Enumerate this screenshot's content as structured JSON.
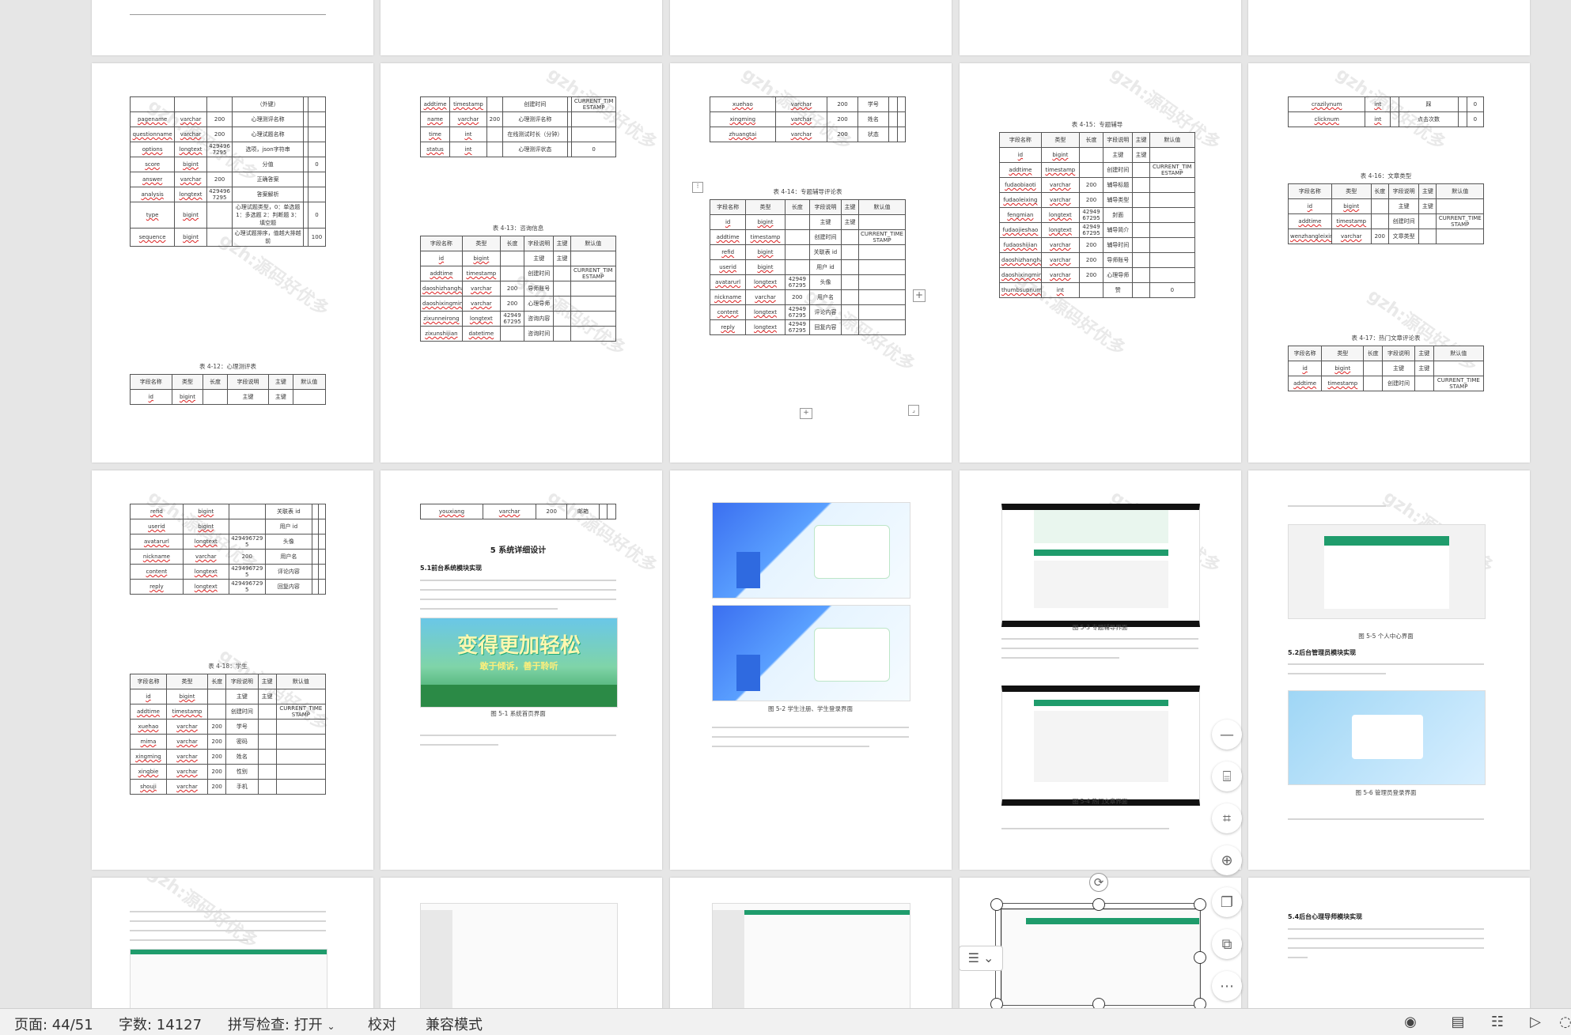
{
  "watermark": "gzh:源码好优多",
  "pages": {
    "p1": {
      "rows": [
        [
          "",
          "",
          "",
          "（外键）",
          "",
          ""
        ],
        [
          "pagename",
          "varchar",
          "200",
          "心理测评名称",
          "",
          ""
        ],
        [
          "questionname",
          "varchar",
          "200",
          "心理试题名称",
          "",
          ""
        ],
        [
          "options",
          "longtext",
          "4294967295",
          "选项，json字符串",
          "",
          ""
        ],
        [
          "score",
          "bigint",
          "",
          "分值",
          "",
          "0"
        ],
        [
          "answer",
          "varchar",
          "200",
          "正确答案",
          "",
          ""
        ],
        [
          "analysis",
          "longtext",
          "4294967295",
          "答案解析",
          "",
          ""
        ],
        [
          "type",
          "bigint",
          "",
          "心理试题类型，0：单选题 1：多选题 2：判断题 3：填空题",
          "",
          "0"
        ],
        [
          "sequence",
          "bigint",
          "",
          "心理试题排序，值越大排越前",
          "",
          "100"
        ]
      ],
      "caption": "表 4-12：心理测评表",
      "header": [
        "字段名称",
        "类型",
        "长度",
        "字段说明",
        "主键",
        "默认值"
      ],
      "rows2": [
        [
          "id",
          "bigint",
          "",
          "主键",
          "主键",
          ""
        ]
      ]
    },
    "p2": {
      "rows": [
        [
          "addtime",
          "timestamp",
          "",
          "创建时间",
          "",
          "CURRENT_TIMESTAMP"
        ],
        [
          "name",
          "varchar",
          "200",
          "心理测评名称",
          "",
          ""
        ],
        [
          "time",
          "int",
          "",
          "在线测试时长（分钟）",
          "",
          ""
        ],
        [
          "status",
          "int",
          "",
          "心理测评状态",
          "",
          "0"
        ]
      ],
      "caption": "表 4-13：咨询信息",
      "header": [
        "字段名称",
        "类型",
        "长度",
        "字段说明",
        "主键",
        "默认值"
      ],
      "rows2": [
        [
          "id",
          "bigint",
          "",
          "主键",
          "主键",
          ""
        ],
        [
          "addtime",
          "timestamp",
          "",
          "创建时间",
          "",
          "CURRENT_TIMESTAMP"
        ],
        [
          "daoshizhanghao",
          "varchar",
          "200",
          "导师账号",
          "",
          ""
        ],
        [
          "daoshixingming",
          "varchar",
          "200",
          "心理导师",
          "",
          ""
        ],
        [
          "zixunneirong",
          "longtext",
          "4294967295",
          "咨询内容",
          "",
          ""
        ],
        [
          "zixunshijian",
          "datetime",
          "",
          "咨询时间",
          "",
          ""
        ]
      ]
    },
    "p3": {
      "rows": [
        [
          "xuehao",
          "varchar",
          "200",
          "学号",
          "",
          ""
        ],
        [
          "xingming",
          "varchar",
          "200",
          "姓名",
          "",
          ""
        ],
        [
          "zhuangtai",
          "varchar",
          "200",
          "状态",
          "",
          ""
        ]
      ],
      "caption": "表 4-14：专题辅导评论表",
      "header": [
        "字段名称",
        "类型",
        "长度",
        "字段说明",
        "主键",
        "默认值"
      ],
      "rows2": [
        [
          "id",
          "bigint",
          "",
          "主键",
          "主键",
          ""
        ],
        [
          "addtime",
          "timestamp",
          "",
          "创建时间",
          "",
          "CURRENT_TIMESTAMP"
        ],
        [
          "refid",
          "bigint",
          "",
          "关联表 id",
          "",
          ""
        ],
        [
          "userid",
          "bigint",
          "",
          "用户 id",
          "",
          ""
        ],
        [
          "avatarurl",
          "longtext",
          "4294967295",
          "头像",
          "",
          ""
        ],
        [
          "nickname",
          "varchar",
          "200",
          "用户名",
          "",
          ""
        ],
        [
          "content",
          "longtext",
          "4294967295",
          "评论内容",
          "",
          ""
        ],
        [
          "reply",
          "longtext",
          "4294967295",
          "回复内容",
          "",
          ""
        ]
      ]
    },
    "p4": {
      "caption": "表 4-15：专题辅导",
      "header": [
        "字段名称",
        "类型",
        "长度",
        "字段说明",
        "主键",
        "默认值"
      ],
      "rows": [
        [
          "id",
          "bigint",
          "",
          "主键",
          "主键",
          ""
        ],
        [
          "addtime",
          "timestamp",
          "",
          "创建时间",
          "",
          "CURRENT_TIMESTAMP"
        ],
        [
          "fudaobiaoti",
          "varchar",
          "200",
          "辅导标题",
          "",
          ""
        ],
        [
          "fudaoleixing",
          "varchar",
          "200",
          "辅导类型",
          "",
          ""
        ],
        [
          "fengmian",
          "longtext",
          "4294967295",
          "封面",
          "",
          ""
        ],
        [
          "fudaojieshao",
          "longtext",
          "4294967295",
          "辅导简介",
          "",
          ""
        ],
        [
          "fudaoshijian",
          "varchar",
          "200",
          "辅导时间",
          "",
          ""
        ],
        [
          "daoshizhanghao",
          "varchar",
          "200",
          "导师账号",
          "",
          ""
        ],
        [
          "daoshixingming",
          "varchar",
          "200",
          "心理导师",
          "",
          ""
        ],
        [
          "thumbsupnum",
          "int",
          "",
          "赞",
          "",
          "0"
        ]
      ]
    },
    "p5": {
      "rows": [
        [
          "crazilynum",
          "int",
          "",
          "踩",
          "",
          "0"
        ],
        [
          "clicknum",
          "int",
          "",
          "点击次数",
          "",
          "0"
        ]
      ],
      "caption": "表 4-16：文章类型",
      "header": [
        "字段名称",
        "类型",
        "长度",
        "字段说明",
        "主键",
        "默认值"
      ],
      "rows2": [
        [
          "id",
          "bigint",
          "",
          "主键",
          "主键",
          ""
        ],
        [
          "addtime",
          "timestamp",
          "",
          "创建时间",
          "",
          "CURRENT_TIMESTAMP"
        ],
        [
          "wenzhangleixing",
          "varchar",
          "200",
          "文章类型",
          "",
          ""
        ]
      ],
      "caption2": "表 4-17：热门文章评论表",
      "rows3": [
        [
          "id",
          "bigint",
          "",
          "主键",
          "主键",
          ""
        ],
        [
          "addtime",
          "timestamp",
          "",
          "创建时间",
          "",
          "CURRENT_TIMESTAMP"
        ]
      ]
    },
    "p6": {
      "rows": [
        [
          "refid",
          "bigint",
          "",
          "关联表 id",
          "",
          ""
        ],
        [
          "userid",
          "bigint",
          "",
          "用户 id",
          "",
          ""
        ],
        [
          "avatarurl",
          "longtext",
          "4294967295",
          "头像",
          "",
          ""
        ],
        [
          "nickname",
          "varchar",
          "200",
          "用户名",
          "",
          ""
        ],
        [
          "content",
          "longtext",
          "4294967295",
          "评论内容",
          "",
          ""
        ],
        [
          "reply",
          "longtext",
          "4294967295",
          "回复内容",
          "",
          ""
        ]
      ],
      "caption": "表 4-18：学生",
      "header": [
        "字段名称",
        "类型",
        "长度",
        "字段说明",
        "主键",
        "默认值"
      ],
      "rows2": [
        [
          "id",
          "bigint",
          "",
          "主键",
          "主键",
          ""
        ],
        [
          "addtime",
          "timestamp",
          "",
          "创建时间",
          "",
          "CURRENT_TIMESTAMP"
        ],
        [
          "xuehao",
          "varchar",
          "200",
          "学号",
          "",
          ""
        ],
        [
          "mima",
          "varchar",
          "200",
          "密码",
          "",
          ""
        ],
        [
          "xingming",
          "varchar",
          "200",
          "姓名",
          "",
          ""
        ],
        [
          "xingbie",
          "varchar",
          "200",
          "性别",
          "",
          ""
        ],
        [
          "shouji",
          "varchar",
          "200",
          "手机",
          "",
          ""
        ]
      ]
    },
    "p7": {
      "toprow": [
        "youxiang",
        "varchar",
        "200",
        "邮箱",
        "",
        ""
      ],
      "heading": "5 系统详细设计",
      "sub": "5.1前台系统模块实现",
      "banner_line1": "变得更加轻松",
      "banner_line2": "敢于倾诉，善于聆听",
      "fig": "图 5-1 系统首页界面"
    },
    "p8": {
      "fig": "图 5-2 学生注册、学生登录界面"
    },
    "p9": {
      "fig1": "图 5-3 专题辅导界面",
      "fig2": "图 5-4 热门文章界面"
    },
    "p10": {
      "fig1": "图 5-5 个人中心界面",
      "sub": "5.2后台管理员模块实现",
      "fig2": "图 5-6 管理员登录界面"
    },
    "p15": {
      "sub": "5.4后台心理导师模块实现"
    }
  },
  "status": {
    "page": "页面: 44/51",
    "words": "字数: 14127",
    "spell": "拼写检查: 打开",
    "proof": "校对",
    "compat": "兼容模式"
  }
}
